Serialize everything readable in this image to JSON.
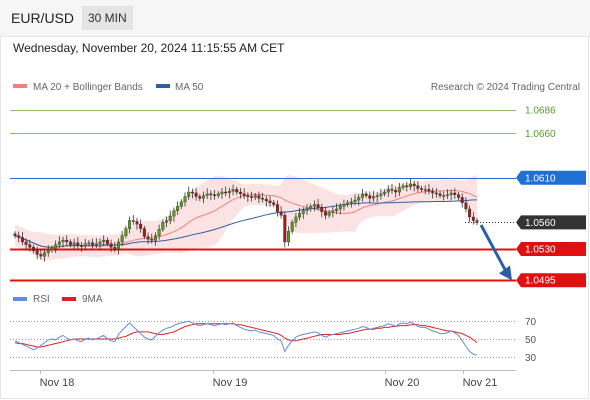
{
  "header": {
    "symbol": "EUR/USD",
    "timeframe": "30 MIN",
    "datetime": "Wednesday, November 20, 2024 11:15:55 AM CET"
  },
  "legend": {
    "ma20": "MA 20 + Bollinger Bands",
    "ma50": "MA 50",
    "credit": "Research © 2024 Trading Central",
    "rsi": "RSI",
    "rsi_ma": "9MA"
  },
  "colors": {
    "ma20": "#f08080",
    "ma50": "#2f5f9e",
    "resistance_far": "#8ec06a",
    "pivot": "#1f6fd6",
    "support": "#e01010",
    "current": "#333333",
    "arrow": "#2a5fa8",
    "rsi": "#5b8ee0",
    "rsi_ma": "#e02020",
    "candle_up": "#5a9c1a",
    "candle_down": "#a81818"
  },
  "chart_data": {
    "type": "candlestick",
    "price_range": [
      1.0484,
      1.0703
    ],
    "x_ticks": [
      "Nov 18",
      "Nov 19",
      "Nov 20",
      "Nov 21"
    ],
    "levels": [
      {
        "value": "1.0686",
        "kind": "resistance_far"
      },
      {
        "value": "1.0660",
        "kind": "resistance_far"
      },
      {
        "value": "1.0610",
        "kind": "pivot"
      },
      {
        "value": "1.0560",
        "kind": "current"
      },
      {
        "value": "1.0530",
        "kind": "support"
      },
      {
        "value": "1.0495",
        "kind": "support"
      }
    ],
    "forecast_arrow": {
      "from": 1.0557,
      "to": 1.0497
    },
    "closes": [
      1.0545,
      1.0543,
      1.0538,
      1.0535,
      1.0532,
      1.0528,
      1.0524,
      1.0522,
      1.0526,
      1.0529,
      1.0531,
      1.0535,
      1.0538,
      1.054,
      1.0538,
      1.0535,
      1.0537,
      1.0534,
      1.0533,
      1.0536,
      1.0537,
      1.0535,
      1.0536,
      1.0538,
      1.054,
      1.0536,
      1.0532,
      1.053,
      1.0538,
      1.0545,
      1.0553,
      1.0562,
      1.0561,
      1.0558,
      1.0553,
      1.0544,
      1.0541,
      1.054,
      1.0545,
      1.0552,
      1.056,
      1.0562,
      1.0567,
      1.0573,
      1.0578,
      1.0583,
      1.0589,
      1.0594,
      1.0593,
      1.0589,
      1.0587,
      1.059,
      1.0592,
      1.0591,
      1.059,
      1.0592,
      1.0594,
      1.0593,
      1.0595,
      1.0597,
      1.0594,
      1.0592,
      1.059,
      1.0589,
      1.0588,
      1.059,
      1.0587,
      1.0586,
      1.0584,
      1.0582,
      1.058,
      1.0572,
      1.0568,
      1.0538,
      1.055,
      1.056,
      1.0566,
      1.057,
      1.0573,
      1.0575,
      1.0578,
      1.058,
      1.0577,
      1.0572,
      1.0568,
      1.0571,
      1.0573,
      1.0575,
      1.0578,
      1.058,
      1.0582,
      1.0583,
      1.0585,
      1.0588,
      1.0592,
      1.059,
      1.0587,
      1.0589,
      1.059,
      1.0592,
      1.0594,
      1.0597,
      1.0596,
      1.0594,
      1.0599,
      1.0601,
      1.06,
      1.0603,
      1.0601,
      1.0598,
      1.0597,
      1.0597,
      1.0595,
      1.0593,
      1.0592,
      1.059,
      1.059,
      1.0591,
      1.0593,
      1.0591,
      1.0588,
      1.0582,
      1.0575,
      1.0566,
      1.0562,
      1.056
    ],
    "rsi": {
      "ticks": [
        70,
        50,
        30
      ],
      "range": [
        22,
        78
      ],
      "rsi": [
        48,
        46,
        44,
        42,
        40,
        38,
        40,
        43,
        46,
        49,
        50,
        49,
        52,
        54,
        51,
        49,
        50,
        48,
        47,
        50,
        51,
        49,
        50,
        52,
        54,
        50,
        48,
        47,
        55,
        60,
        64,
        68,
        64,
        60,
        56,
        52,
        50,
        49,
        53,
        57,
        60,
        62,
        63,
        65,
        67,
        68,
        69,
        70,
        68,
        66,
        65,
        66,
        67,
        66,
        65,
        66,
        67,
        66,
        67,
        68,
        65,
        63,
        61,
        60,
        59,
        60,
        58,
        57,
        56,
        55,
        54,
        50,
        48,
        36,
        43,
        48,
        52,
        54,
        55,
        56,
        57,
        58,
        57,
        54,
        52,
        54,
        55,
        56,
        57,
        58,
        59,
        60,
        61,
        62,
        64,
        63,
        61,
        62,
        63,
        64,
        65,
        67,
        66,
        64,
        67,
        68,
        67,
        69,
        67,
        64,
        63,
        63,
        61,
        59,
        58,
        56,
        56,
        57,
        59,
        57,
        54,
        48,
        42,
        36,
        33,
        32
      ],
      "ma": [
        46,
        45,
        45,
        44,
        43,
        42,
        41,
        41,
        42,
        43,
        44,
        45,
        46,
        47,
        48,
        49,
        50,
        50,
        50,
        50,
        50,
        50,
        50,
        50,
        50,
        50,
        50,
        50,
        51,
        52,
        53,
        55,
        57,
        58,
        58,
        58,
        58,
        57,
        56,
        55,
        55,
        56,
        57,
        58,
        60,
        62,
        64,
        65,
        66,
        67,
        67,
        67,
        67,
        67,
        67,
        67,
        67,
        67,
        67,
        67,
        66,
        66,
        65,
        64,
        63,
        62,
        61,
        60,
        59,
        58,
        57,
        56,
        54,
        51,
        49,
        48,
        48,
        49,
        50,
        51,
        52,
        53,
        54,
        55,
        55,
        55,
        55,
        55,
        55,
        56,
        56,
        57,
        58,
        59,
        60,
        61,
        61,
        61,
        62,
        62,
        63,
        63,
        64,
        64,
        65,
        65,
        65,
        66,
        66,
        66,
        65,
        65,
        64,
        63,
        62,
        61,
        60,
        59,
        59,
        58,
        57,
        56,
        54,
        52,
        49,
        46
      ]
    }
  }
}
